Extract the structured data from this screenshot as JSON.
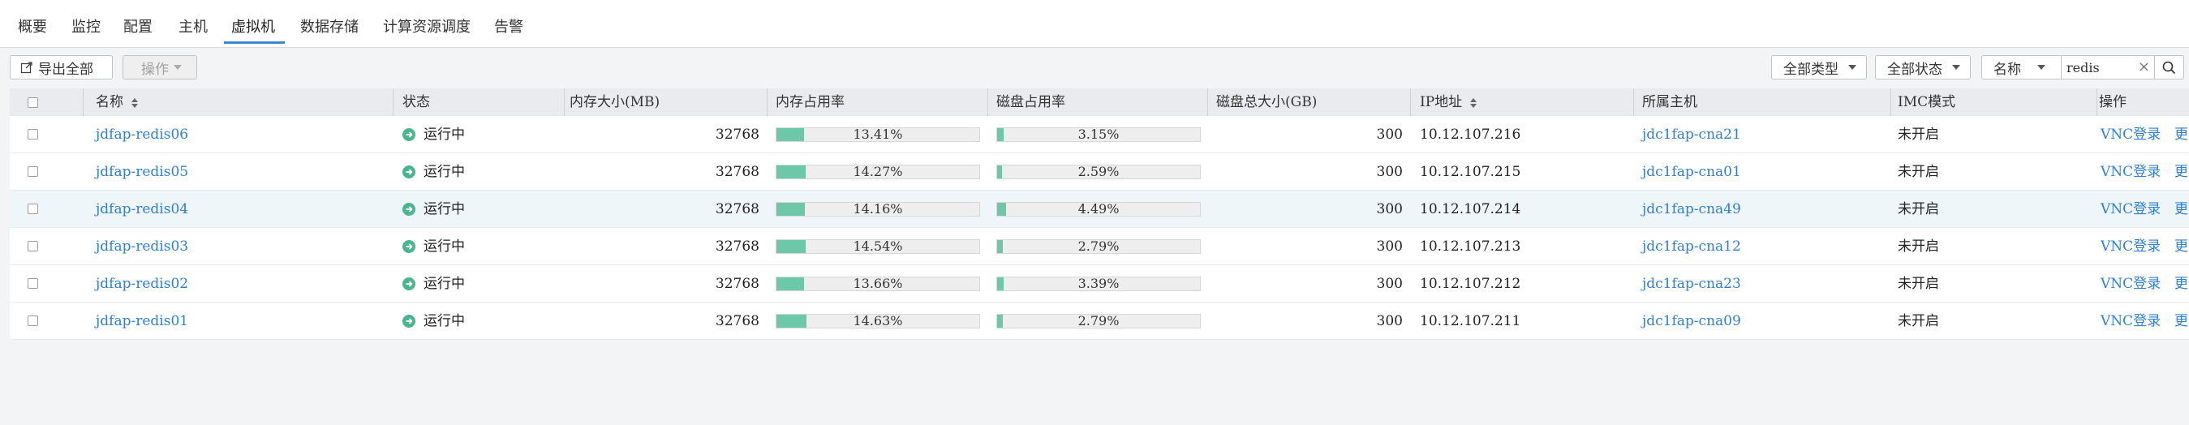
{
  "tabs": [
    {
      "label": "概要"
    },
    {
      "label": "监控"
    },
    {
      "label": "配置"
    },
    {
      "label": "主机"
    },
    {
      "label": "虚拟机"
    },
    {
      "label": "数据存储"
    },
    {
      "label": "计算资源调度"
    },
    {
      "label": "告警"
    }
  ],
  "active_tab": "虚拟机",
  "toolbar": {
    "export_all": "导出全部",
    "operation": "操作",
    "filter_type": "全部类型",
    "filter_status": "全部状态",
    "search_field": "名称",
    "search_value": "redis"
  },
  "table": {
    "headers": {
      "name": "名称",
      "status": "状态",
      "mem_size": "内存大小(MB)",
      "mem_usage": "内存占用率",
      "disk_usage": "磁盘占用率",
      "disk_total": "磁盘总大小(GB)",
      "ip": "IP地址",
      "host": "所属主机",
      "imc": "IMC模式",
      "action": "操作"
    },
    "rows": [
      {
        "name": "jdfap-redis06",
        "status": "运行中",
        "mem_size": "32768",
        "mem_usage": "13.41%",
        "mem_pct": 13.41,
        "disk_usage": "3.15%",
        "disk_pct": 3.15,
        "disk_total": "300",
        "ip": "10.12.107.216",
        "host": "jdc1fap-cna21",
        "imc": "未开启",
        "vnc": "VNC登录",
        "more": "更"
      },
      {
        "name": "jdfap-redis05",
        "status": "运行中",
        "mem_size": "32768",
        "mem_usage": "14.27%",
        "mem_pct": 14.27,
        "disk_usage": "2.59%",
        "disk_pct": 2.59,
        "disk_total": "300",
        "ip": "10.12.107.215",
        "host": "jdc1fap-cna01",
        "imc": "未开启",
        "vnc": "VNC登录",
        "more": "更"
      },
      {
        "name": "jdfap-redis04",
        "status": "运行中",
        "mem_size": "32768",
        "mem_usage": "14.16%",
        "mem_pct": 14.16,
        "disk_usage": "4.49%",
        "disk_pct": 4.49,
        "disk_total": "300",
        "ip": "10.12.107.214",
        "host": "jdc1fap-cna49",
        "imc": "未开启",
        "vnc": "VNC登录",
        "more": "更"
      },
      {
        "name": "jdfap-redis03",
        "status": "运行中",
        "mem_size": "32768",
        "mem_usage": "14.54%",
        "mem_pct": 14.54,
        "disk_usage": "2.79%",
        "disk_pct": 2.79,
        "disk_total": "300",
        "ip": "10.12.107.213",
        "host": "jdc1fap-cna12",
        "imc": "未开启",
        "vnc": "VNC登录",
        "more": "更"
      },
      {
        "name": "jdfap-redis02",
        "status": "运行中",
        "mem_size": "32768",
        "mem_usage": "13.66%",
        "mem_pct": 13.66,
        "disk_usage": "3.39%",
        "disk_pct": 3.39,
        "disk_total": "300",
        "ip": "10.12.107.212",
        "host": "jdc1fap-cna23",
        "imc": "未开启",
        "vnc": "VNC登录",
        "more": "更"
      },
      {
        "name": "jdfap-redis01",
        "status": "运行中",
        "mem_size": "32768",
        "mem_usage": "14.63%",
        "mem_pct": 14.63,
        "disk_usage": "2.79%",
        "disk_pct": 2.79,
        "disk_total": "300",
        "ip": "10.12.107.211",
        "host": "jdc1fap-cna09",
        "imc": "未开启",
        "vnc": "VNC登录",
        "more": "更"
      }
    ]
  },
  "colors": {
    "link": "#2f7fd2",
    "progress": "#6cc8a8",
    "running": "#4bb58f",
    "active_tab": "#3b86d8"
  }
}
